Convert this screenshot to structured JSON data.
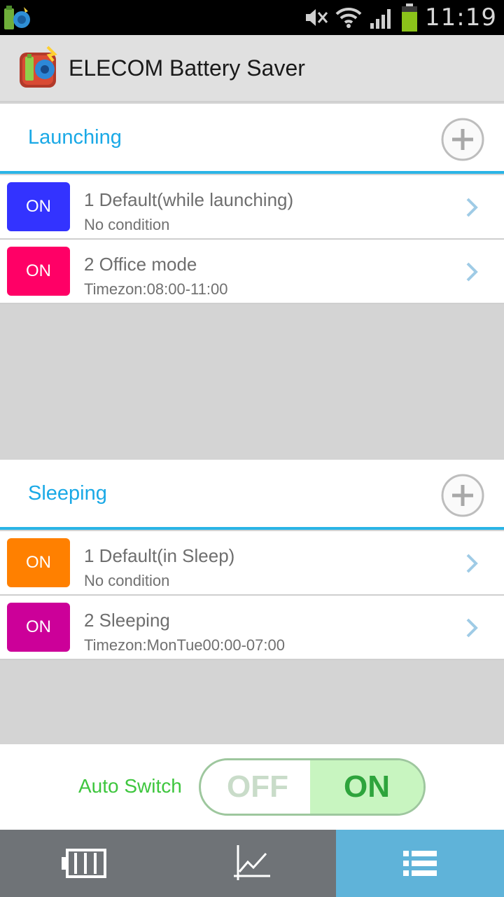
{
  "status_bar": {
    "time": "11:19",
    "icons": [
      "app-notification-icon",
      "mute-icon",
      "wifi-icon",
      "signal-icon",
      "battery-icon"
    ]
  },
  "action_bar": {
    "title": "ELECOM Battery Saver",
    "logo_icon": "app-logo-icon"
  },
  "sections": [
    {
      "title": "Launching",
      "add_icon": "add-circle-icon",
      "items": [
        {
          "badge": "ON",
          "badge_color": "#3333ff",
          "title": "1 Default(while launching)",
          "subtitle": "No condition"
        },
        {
          "badge": "ON",
          "badge_color": "#ff0066",
          "title": "2 Office mode",
          "subtitle": "Timezon:08:00-11:00"
        }
      ]
    },
    {
      "title": "Sleeping",
      "add_icon": "add-circle-icon",
      "items": [
        {
          "badge": "ON",
          "badge_color": "#ff8000",
          "title": "1 Default(in Sleep)",
          "subtitle": "No condition"
        },
        {
          "badge": "ON",
          "badge_color": "#cc0099",
          "title": "2 Sleeping",
          "subtitle": "Timezon:MonTue00:00-07:00"
        }
      ]
    }
  ],
  "auto_switch": {
    "label": "Auto Switch",
    "off_label": "OFF",
    "on_label": "ON",
    "state": "on"
  },
  "tabs": [
    {
      "icon": "battery-tab-icon",
      "active": false
    },
    {
      "icon": "graph-tab-icon",
      "active": false
    },
    {
      "icon": "list-tab-icon",
      "active": true
    }
  ],
  "colors": {
    "accent": "#2ab4e6",
    "switch_green": "#3ec63e",
    "active_tab": "#5fb3d9",
    "inactive_tab": "#6f7377"
  }
}
